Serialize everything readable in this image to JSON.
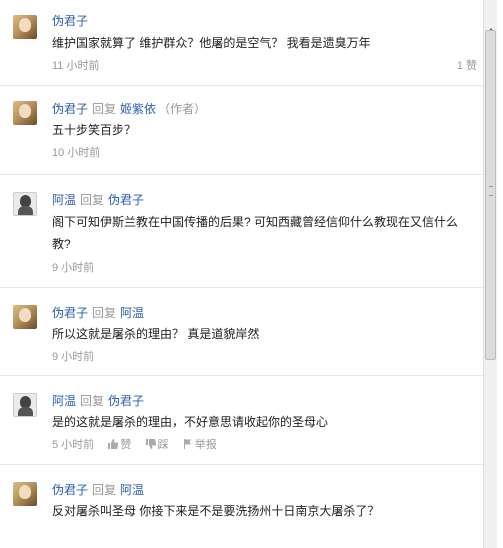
{
  "comments": [
    {
      "author": "伪君子",
      "text": "维护国家就算了 维护群众？他屠的是空气？ 我看是遗臭万年",
      "time": "11 小时前",
      "likes": "1 赞"
    },
    {
      "author": "伪君子",
      "reply_label": "回复",
      "reply_to": "姬紫依",
      "role": "（作者）",
      "text": "五十步笑百步？",
      "time": "10 小时前"
    },
    {
      "author": "阿温",
      "reply_label": "回复",
      "reply_to": "伪君子",
      "text": "阁下可知伊斯兰教在中国传播的后果? 可知西藏曾经信仰什么教现在又信什么教?",
      "time": "9 小时前"
    },
    {
      "author": "伪君子",
      "reply_label": "回复",
      "reply_to": "阿温",
      "text": "所以这就是屠杀的理由？ 真是道貌岸然",
      "time": "9 小时前"
    },
    {
      "author": "阿温",
      "reply_label": "回复",
      "reply_to": "伪君子",
      "text": "是的这就是屠杀的理由，不好意思请收起你的圣母心",
      "time": "5 小时前",
      "actions": {
        "like": "赞",
        "dislike": "踩",
        "report": "举报"
      }
    },
    {
      "author": "伪君子",
      "reply_label": "回复",
      "reply_to": "阿温",
      "text": "反对屠杀叫圣母 你接下来是不是要洗扬州十日南京大屠杀了？"
    }
  ]
}
